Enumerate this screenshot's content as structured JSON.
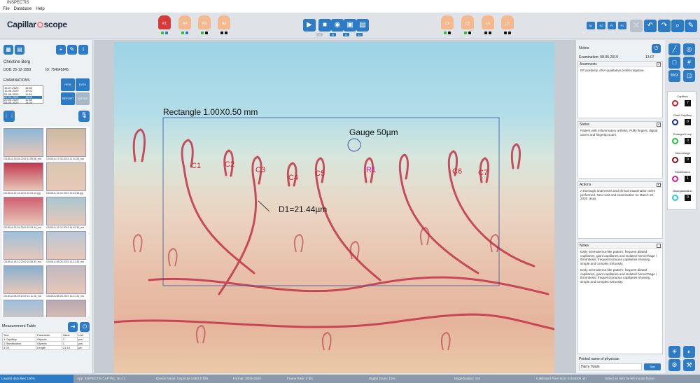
{
  "window": {
    "title": "INSPECTIS"
  },
  "menu": [
    "File",
    "Database",
    "Help"
  ],
  "logo": {
    "text_a": "Capillar",
    "text_b": "scope"
  },
  "fingers_left": [
    {
      "label": "R1",
      "active": true,
      "dots": [
        "#2fbf3f",
        "#2d7bc4"
      ]
    },
    {
      "label": "R4",
      "active": false,
      "dots": [
        "#2fbf3f",
        "#2d7bc4"
      ]
    },
    {
      "label": "R3",
      "active": false,
      "dots": [
        "#2fbf3f",
        "#111111"
      ]
    },
    {
      "label": "R2",
      "active": false,
      "dots": [
        "#111111",
        "#111111"
      ]
    }
  ],
  "fingers_right": [
    {
      "label": "L2",
      "dots": [
        "#2fbf3f",
        "#111111"
      ]
    },
    {
      "label": "L3",
      "dots": [
        "#2fbf3f",
        "#111111"
      ]
    },
    {
      "label": "L4",
      "dots": [
        "#111111",
        "#111111"
      ]
    },
    {
      "label": "L5",
      "dots": [
        "#111111",
        "#111111"
      ]
    }
  ],
  "toolbar_center": {
    "mini_labels": [
      "0",
      "B",
      "O",
      "D"
    ]
  },
  "toolbar_right_pills": [
    "N1",
    "N2",
    "P1",
    "P2"
  ],
  "patient": {
    "name": "Christine Berg",
    "dob_label": "DOB:",
    "dob": "25-12-1950",
    "id_label": "ID:",
    "id": "754645845"
  },
  "examinations": {
    "title": "EXAMINATIONS",
    "rows": [
      {
        "date": "15-07-2020",
        "time": "16:53"
      },
      {
        "date": "16-06-2020",
        "time": "10:32"
      },
      {
        "date": "01-06-2020",
        "time": "11:54"
      },
      {
        "date": "22-05-2020",
        "time": "16:00",
        "selected": true
      },
      {
        "date": "20-05-2020",
        "time": "11:38"
      },
      {
        "date": "08-05-2020",
        "time": "14:04"
      }
    ],
    "buttons": {
      "new": "NEW",
      "data": "DATA",
      "report": "REPORT",
      "notes": "NOTES"
    }
  },
  "thumbnails": [
    {
      "caption": "CB-85-A-30-05-2019 11.55.56_ma",
      "color": "#8bb8d8"
    },
    {
      "caption": "CB-85-A-17-06-2019 11.34.35_ma",
      "color": "#c9b9a0"
    },
    {
      "caption": "CB-85-A-22-04-2019 15.53.19.jpg",
      "color": "#c03a50"
    },
    {
      "caption": "CB-85-A-22-04-2019 15.53.36.jpg",
      "color": "#d8c8b0"
    },
    {
      "caption": "CB-85-A-22-04-2019 15.53.34_ma",
      "color": "#d06070"
    },
    {
      "caption": "CB-85-A-22-04-2019 15.53.36_ma",
      "color": "#a8c8d0"
    },
    {
      "caption": "CB-85-A-18-12-2019 15.56.30_ma",
      "color": "#9cc0dc"
    },
    {
      "caption": "CB-85-A-08-05-2019 13.21.38_ma",
      "color": "#b8c8d8"
    },
    {
      "caption": "CB-85-A-08-05-2019 13.11.46_ma",
      "color": "#88b0d0"
    },
    {
      "caption": "CB-85-A-08-05-2019 13.11.45_ma",
      "color": "#c0b8c0"
    },
    {
      "caption": "",
      "color": "#9cc0dc"
    },
    {
      "caption": "",
      "color": "#b8a8b0"
    }
  ],
  "measurement_table": {
    "title": "Measurement Table",
    "headers": [
      "Tool",
      "Parameter",
      "Value",
      "Unit"
    ],
    "rows": [
      [
        "1 Capillary",
        "Objects",
        "7",
        "pcs"
      ],
      [
        "2 Ramification",
        "Objects",
        "1",
        "pcs"
      ],
      [
        "3 D1",
        "Length",
        "21.44",
        "µm"
      ]
    ]
  },
  "overlay": {
    "rectangle_label": "Rectangle 1.00X0.50 mm",
    "gauge_label": "Gauge 50µm",
    "d1_label": "D1=21.44µm",
    "markers": [
      "C1",
      "C2",
      "C3",
      "C4",
      "C5",
      "R1",
      "C6",
      "C7"
    ]
  },
  "notes_panel": {
    "title": "Notes",
    "exam_label": "Examination: 08-05-2019",
    "exam_time": "13.07",
    "anamnesis": {
      "title": "Anamnesis",
      "text": "RF positivity. ANA qualitative profile negative."
    },
    "status": {
      "title": "Status",
      "text": "Patient with inflammatory arthritis. Puffy fingers, digital ulcers and fingertip scars."
    },
    "actions": {
      "title": "Actions",
      "text": "A thorough anamnesis and clinical examination were performed. Next visit and examination on March 10, 2020. asas"
    },
    "notes": {
      "title": "Notes",
      "text": "Early scleroderma-like pattern: frequent dilated capillaries, giant capillaries and isolated hemorrhage / thrombosis; frequent tortuous capillaries showing simple and complex tortuosity.",
      "text2": "Early scleroderma-like pattern: frequent dilated capillaries, giant capillaries and isolated hemorrhage / thrombosis; frequent tortuous capillaries showing simple and complex tortuosity."
    },
    "physician_label": "Printed name of physician",
    "physician_value": "Harry Twain",
    "sign_button": "Sign"
  },
  "tools": {
    "zoom_label": "300X"
  },
  "categories": [
    {
      "label": "Capillary",
      "color": "#c0202a",
      "count": "7"
    },
    {
      "label": "Giant Capillary",
      "color": "#1a2a9a",
      "count": "0"
    },
    {
      "label": "Enlarged Loop",
      "color": "#22c040",
      "count": "0"
    },
    {
      "label": "Hemorrhage",
      "color": "#7a1020",
      "count": "0"
    },
    {
      "label": "Ramification",
      "color": "#d0208a",
      "count": "1"
    },
    {
      "label": "Disorganization",
      "color": "#30c8d8",
      "count": "0"
    }
  ],
  "statusbar": [
    "Loaded data files 100%",
    "App: INSPECTIS CAP Pro, 15.4.2",
    "Device Name: Inspectis USB3.0 DM",
    "Format: 2000x1500",
    "Frame Rate: 0 fps",
    "Digital Zoom: 10%",
    "Magnification: 10x",
    "Calibrated Pixel Size: 0.053000 um",
    "Select an item by left mouse button"
  ]
}
